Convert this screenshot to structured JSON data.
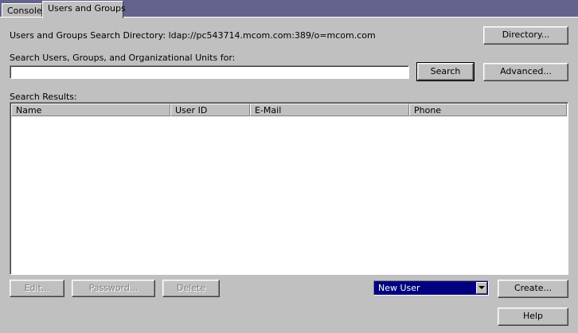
{
  "tabs": [
    {
      "label": "Console"
    },
    {
      "label": "Users and Groups"
    }
  ],
  "directory": {
    "label": "Users and Groups Search Directory: ldap://pc543714.mcom.com:389/o=mcom.com",
    "button": "Directory..."
  },
  "search": {
    "label": "Search Users, Groups, and Organizational Units for:",
    "value": "",
    "search_button": "Search",
    "advanced_button": "Advanced..."
  },
  "results": {
    "label": "Search Results:",
    "columns": [
      "Name",
      "User ID",
      "E-Mail",
      "Phone"
    ],
    "rows": []
  },
  "actions": {
    "edit": "Edit...",
    "password": "Password...",
    "delete": "Delete",
    "new_type": "New User",
    "create": "Create...",
    "help": "Help"
  },
  "colors": {
    "title_band": "#63638c",
    "panel": "#c0c0c0",
    "selection": "#000080"
  }
}
